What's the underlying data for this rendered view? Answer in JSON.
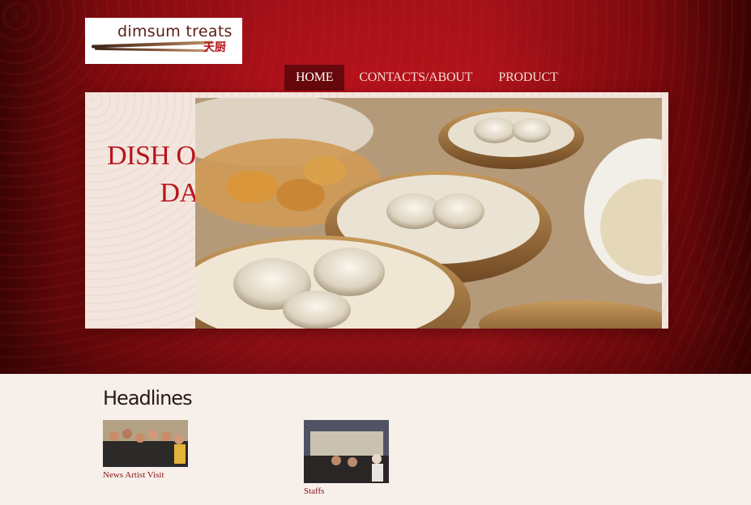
{
  "logo": {
    "brand_text": "dimsum treats",
    "chinese_text": "天厨"
  },
  "nav": {
    "items": [
      {
        "label": "HOME",
        "active": true
      },
      {
        "label": "CONTACTS/ABOUT",
        "active": false
      },
      {
        "label": "PRODUCT",
        "active": false
      }
    ]
  },
  "banner": {
    "title_line1": "DISH OF THE",
    "title_line2": "DAY"
  },
  "headlines": {
    "title": "Headlines",
    "items": [
      {
        "caption": "News Artist Visit"
      },
      {
        "caption": "Staffs"
      }
    ]
  },
  "colors": {
    "brand_red": "#b8141c",
    "header_red": "#a3121a",
    "page_background": "#f7efea",
    "link": "#8a1418"
  }
}
